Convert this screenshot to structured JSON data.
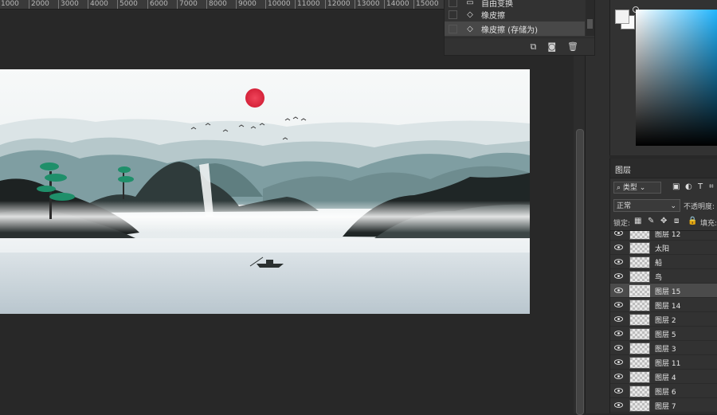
{
  "ruler": {
    "labels": [
      "1000",
      "2000",
      "3000",
      "4000",
      "5000",
      "6000",
      "7000",
      "8000",
      "9000",
      "10000",
      "11000",
      "12000",
      "13000",
      "14000",
      "15000"
    ]
  },
  "history": {
    "items": [
      {
        "label": "自由变换",
        "icon": "free-transform-icon"
      },
      {
        "label": "橡皮擦",
        "icon": "eraser-icon"
      },
      {
        "label": "橡皮擦 (存储为)",
        "icon": "eraser-icon",
        "active": true
      }
    ],
    "tool_icons": [
      "new-document-from-state-icon",
      "camera-icon",
      "trash-icon"
    ]
  },
  "color": {
    "foreground": "#f2f2f2",
    "background": "#fafafa",
    "picker_hue": "#1fb5ff"
  },
  "layers": {
    "tab_label": "图层",
    "filter_kind": "类型",
    "blend_mode": "正常",
    "opacity_label": "不透明度:",
    "lock_label": "锁定:",
    "fill_label": "填充:",
    "items": [
      {
        "name": "图层 12",
        "selected": false
      },
      {
        "name": "太阳",
        "selected": false
      },
      {
        "name": "船",
        "selected": false
      },
      {
        "name": "鸟",
        "selected": false
      },
      {
        "name": "图层 15",
        "selected": true
      },
      {
        "name": "图层 14",
        "selected": false
      },
      {
        "name": "图层 2",
        "selected": false
      },
      {
        "name": "图层 5",
        "selected": false
      },
      {
        "name": "图层 3",
        "selected": false
      },
      {
        "name": "图层 11",
        "selected": false
      },
      {
        "name": "图层 4",
        "selected": false
      },
      {
        "name": "图层 6",
        "selected": false
      },
      {
        "name": "图层 7",
        "selected": false
      }
    ]
  }
}
